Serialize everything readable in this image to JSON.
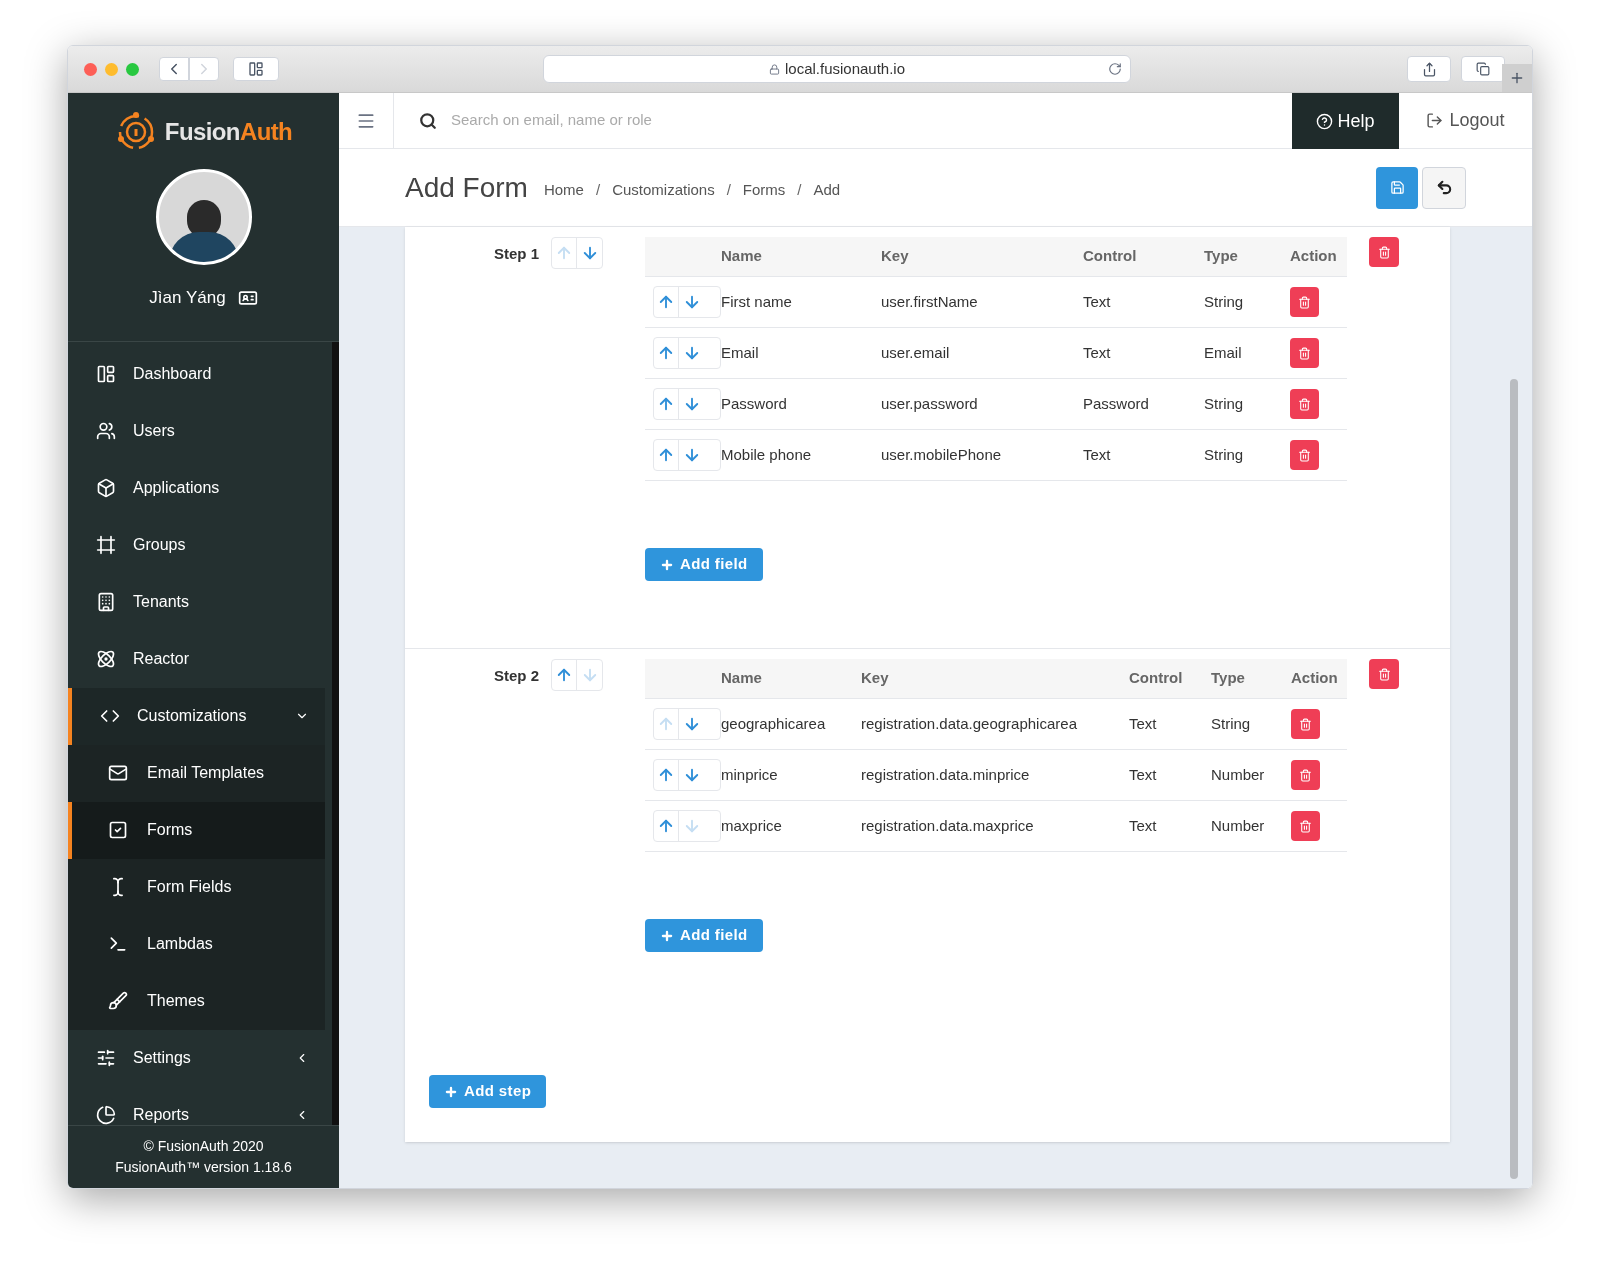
{
  "browser": {
    "url": "local.fusionauth.io"
  },
  "sidebar": {
    "brand": {
      "first": "Fusion",
      "second": "Auth"
    },
    "user_name": "Jìan Yáng",
    "items": [
      {
        "label": "Dashboard",
        "selected": false
      },
      {
        "label": "Users",
        "selected": false
      },
      {
        "label": "Applications",
        "selected": false
      },
      {
        "label": "Groups",
        "selected": false
      },
      {
        "label": "Tenants",
        "selected": false
      },
      {
        "label": "Reactor",
        "selected": false
      },
      {
        "label": "Customizations",
        "selected": true,
        "expanded": true,
        "children": [
          {
            "label": "Email Templates",
            "selected": false
          },
          {
            "label": "Forms",
            "selected": true
          },
          {
            "label": "Form Fields",
            "selected": false
          },
          {
            "label": "Lambdas",
            "selected": false
          },
          {
            "label": "Themes",
            "selected": false
          }
        ]
      },
      {
        "label": "Settings",
        "selected": false,
        "expanded": false
      },
      {
        "label": "Reports",
        "selected": false,
        "expanded": false
      }
    ],
    "footer": [
      "© FusionAuth 2020",
      "FusionAuth™ version 1.18.6"
    ]
  },
  "topbar": {
    "search_placeholder": "Search on email, name or role",
    "help": "Help",
    "logout": "Logout"
  },
  "page": {
    "title": "Add Form",
    "breadcrumbs": [
      {
        "kind": "link",
        "label": "Home"
      },
      {
        "kind": "separator",
        "label": "/"
      },
      {
        "kind": "link",
        "label": "Customizations"
      },
      {
        "kind": "separator",
        "label": "/"
      },
      {
        "kind": "link",
        "label": "Forms"
      },
      {
        "kind": "separator",
        "label": "/"
      },
      {
        "kind": "link",
        "label": "Add"
      }
    ]
  },
  "steps": [
    {
      "label": "Step 1",
      "up_enabled": false,
      "down_enabled": true,
      "columns": [
        "Name",
        "Key",
        "Control",
        "Type",
        "Action"
      ],
      "fields": [
        {
          "name": "First name",
          "key": "user.firstName",
          "control": "Text",
          "type": "String",
          "up_enabled": true,
          "down_enabled": true
        },
        {
          "name": "Email",
          "key": "user.email",
          "control": "Text",
          "type": "Email",
          "up_enabled": true,
          "down_enabled": true
        },
        {
          "name": "Password",
          "key": "user.password",
          "control": "Password",
          "type": "String",
          "up_enabled": true,
          "down_enabled": true
        },
        {
          "name": "Mobile phone",
          "key": "user.mobilePhone",
          "control": "Text",
          "type": "String",
          "up_enabled": true,
          "down_enabled": true
        }
      ],
      "add_field": "Add field"
    },
    {
      "label": "Step 2",
      "up_enabled": true,
      "down_enabled": false,
      "columns": [
        "Name",
        "Key",
        "Control",
        "Type",
        "Action"
      ],
      "fields": [
        {
          "name": "geographicarea",
          "key": "registration.data.geographicarea",
          "control": "Text",
          "type": "String",
          "up_enabled": false,
          "down_enabled": true
        },
        {
          "name": "minprice",
          "key": "registration.data.minprice",
          "control": "Text",
          "type": "Number",
          "up_enabled": true,
          "down_enabled": true
        },
        {
          "name": "maxprice",
          "key": "registration.data.maxprice",
          "control": "Text",
          "type": "Number",
          "up_enabled": true,
          "down_enabled": false
        }
      ],
      "add_field": "Add field"
    }
  ],
  "add_step": "Add step"
}
